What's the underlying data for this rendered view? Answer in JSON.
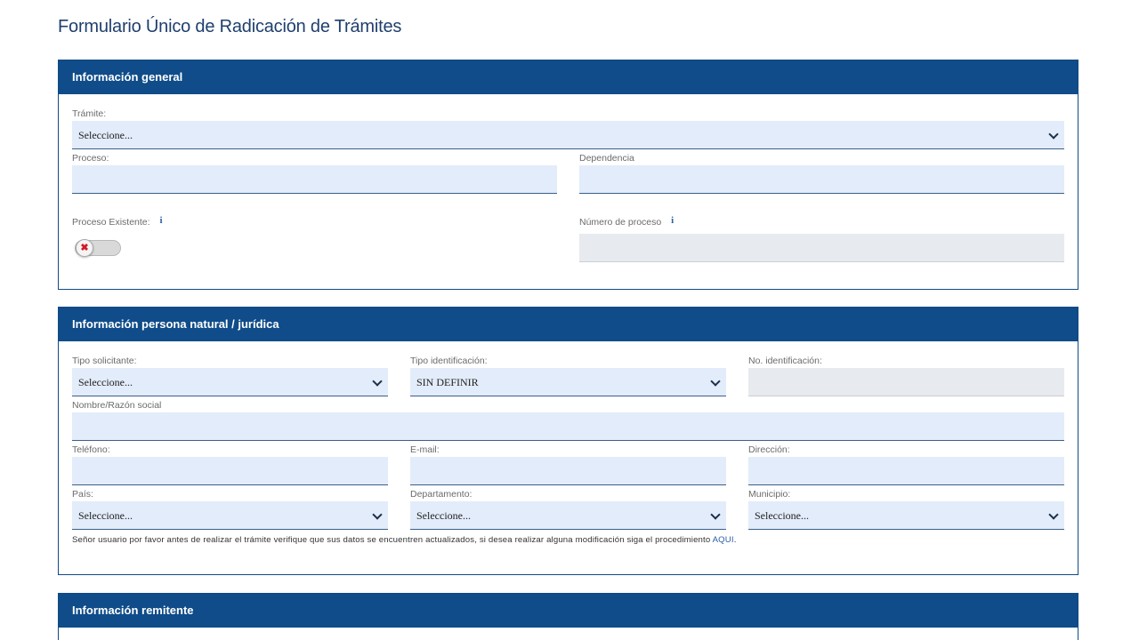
{
  "page": {
    "title": "Formulario Único de Radicación de Trámites"
  },
  "general": {
    "header": "Información general",
    "tramite": {
      "label": "Trámite:",
      "value": "Seleccione..."
    },
    "proceso": {
      "label": "Proceso:",
      "value": ""
    },
    "dependencia": {
      "label": "Dependencia",
      "value": ""
    },
    "proceso_existente": {
      "label": "Proceso Existente:",
      "info": "i",
      "toggle_state": "off",
      "toggle_symbol": "✖"
    },
    "numero_proceso": {
      "label": "Número de proceso",
      "info": "i",
      "value": ""
    }
  },
  "persona": {
    "header": "Información persona natural / jurídica",
    "tipo_solicitante": {
      "label": "Tipo solicitante:",
      "value": "Seleccione..."
    },
    "tipo_identificacion": {
      "label": "Tipo identificación:",
      "value": "SIN DEFINIR"
    },
    "no_identificacion": {
      "label": "No. identificación:",
      "value": ""
    },
    "nombre": {
      "label": "Nombre/Razón social",
      "value": ""
    },
    "telefono": {
      "label": "Teléfono:",
      "value": ""
    },
    "email": {
      "label": "E-mail:",
      "value": ""
    },
    "direccion": {
      "label": "Dirección:",
      "value": ""
    },
    "pais": {
      "label": "País:",
      "value": "Seleccione..."
    },
    "departamento": {
      "label": "Departamento:",
      "value": "Seleccione..."
    },
    "municipio": {
      "label": "Municipio:",
      "value": "Seleccione..."
    },
    "notice_text": "Señor usuario por favor antes de realizar el trámite verifique que sus datos se encuentren actualizados, si desea realizar alguna modificación siga el procedimiento ",
    "notice_link": "AQUI",
    "notice_end": "."
  },
  "remitente": {
    "header": "Información remitente"
  },
  "colors": {
    "header_bg": "#0f4c89",
    "input_bg": "#e3ecfa",
    "disabled_bg": "#e7eaee",
    "title": "#1f3f6e"
  }
}
